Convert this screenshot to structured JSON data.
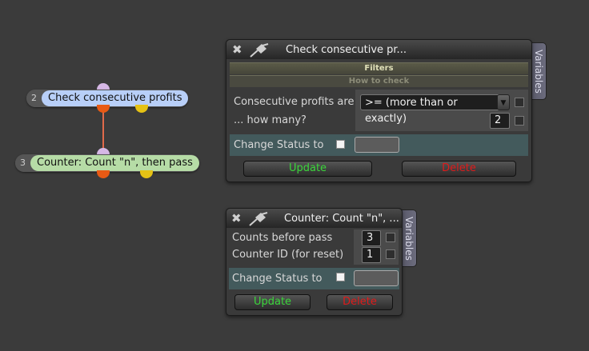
{
  "nodes": [
    {
      "num": "2",
      "label": "Check consecutive profits",
      "color": "#b8cff8"
    },
    {
      "num": "3",
      "label": "Counter: Count \"n\", then pass",
      "color": "#b6dca6"
    }
  ],
  "panel1": {
    "title": "Check consecutive pr...",
    "side_tab": "Variables",
    "section_filters": "Filters",
    "section_how": "How to check",
    "row1_label": "Consecutive profits are",
    "row1_value": ">= (more than or exactly)",
    "row2_label": "... how many?",
    "row2_value": "2",
    "status_label": "Change Status to",
    "update_label": "Update",
    "delete_label": "Delete"
  },
  "panel2": {
    "title": "Counter: Count \"n\", ...",
    "side_tab": "Variables",
    "row1_label": "Counts before pass",
    "row1_value": "3",
    "row2_label": "Counter ID (for reset)",
    "row2_value": "1",
    "status_label": "Change Status to",
    "update_label": "Update",
    "delete_label": "Delete"
  },
  "icons": {
    "close": "close-icon",
    "pin": "pin-icon"
  },
  "colors": {
    "update": "#3bd63b",
    "delete": "#e01a1a",
    "connector": "#e06a4a",
    "output_orange": "#e85a14",
    "output_yellow": "#e5c215",
    "input_pink": "#d6b8e6"
  }
}
